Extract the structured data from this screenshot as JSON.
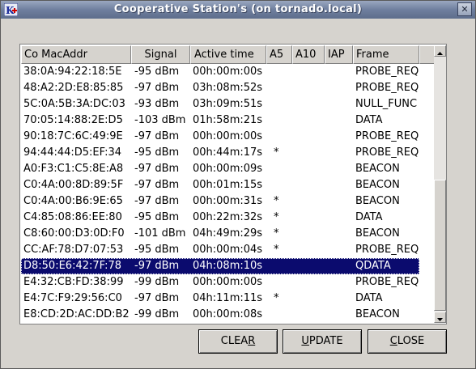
{
  "window": {
    "title": "Cooperative Station's (on tornado.local)",
    "icons": {
      "app": "app-icon",
      "close": "close-icon"
    }
  },
  "table": {
    "columns": [
      "Co MacAddr",
      "Signal",
      "Active time",
      "A5",
      "A10",
      "IAP",
      "Frame"
    ],
    "rows": [
      {
        "mac": "38:0A:94:22:18:5E",
        "signal": "-95 dBm",
        "active": "00h:00m:00s",
        "a5": "",
        "a10": "",
        "iap": "",
        "frame": "PROBE_REQ"
      },
      {
        "mac": "48:A2:2D:E8:85:85",
        "signal": "-97 dBm",
        "active": "03h:08m:52s",
        "a5": "",
        "a10": "",
        "iap": "",
        "frame": "PROBE_REQ"
      },
      {
        "mac": "5C:0A:5B:3A:DC:03",
        "signal": "-93 dBm",
        "active": "03h:09m:51s",
        "a5": "",
        "a10": "",
        "iap": "",
        "frame": "NULL_FUNC"
      },
      {
        "mac": "70:05:14:88:2E:D5",
        "signal": "-103 dBm",
        "active": "01h:58m:21s",
        "a5": "",
        "a10": "",
        "iap": "",
        "frame": "DATA"
      },
      {
        "mac": "90:18:7C:6C:49:9E",
        "signal": "-97 dBm",
        "active": "00h:00m:00s",
        "a5": "",
        "a10": "",
        "iap": "",
        "frame": "PROBE_REQ"
      },
      {
        "mac": "94:44:44:D5:EF:34",
        "signal": "-95 dBm",
        "active": "00h:44m:17s",
        "a5": "*",
        "a10": "",
        "iap": "",
        "frame": "PROBE_REQ"
      },
      {
        "mac": "A0:F3:C1:C5:8E:A8",
        "signal": "-97 dBm",
        "active": "00h:00m:09s",
        "a5": "",
        "a10": "",
        "iap": "",
        "frame": "BEACON"
      },
      {
        "mac": "C0:4A:00:8D:89:5F",
        "signal": "-97 dBm",
        "active": "00h:01m:15s",
        "a5": "",
        "a10": "",
        "iap": "",
        "frame": "BEACON"
      },
      {
        "mac": "C0:4A:00:B6:9E:65",
        "signal": "-97 dBm",
        "active": "00h:00m:31s",
        "a5": "*",
        "a10": "",
        "iap": "",
        "frame": "BEACON"
      },
      {
        "mac": "C4:85:08:86:EE:80",
        "signal": "-95 dBm",
        "active": "00h:22m:32s",
        "a5": "*",
        "a10": "",
        "iap": "",
        "frame": "DATA"
      },
      {
        "mac": "C8:60:00:D3:0D:F0",
        "signal": "-101 dBm",
        "active": "04h:49m:29s",
        "a5": "*",
        "a10": "",
        "iap": "",
        "frame": "BEACON"
      },
      {
        "mac": "CC:AF:78:D7:07:53",
        "signal": "-95 dBm",
        "active": "00h:00m:04s",
        "a5": "*",
        "a10": "",
        "iap": "",
        "frame": "PROBE_REQ"
      },
      {
        "mac": "D8:50:E6:42:7F:78",
        "signal": "-97 dBm",
        "active": "04h:08m:10s",
        "a5": "",
        "a10": "",
        "iap": "",
        "frame": "QDATA",
        "selected": true
      },
      {
        "mac": "E4:32:CB:FD:38:99",
        "signal": "-99 dBm",
        "active": "00h:00m:00s",
        "a5": "",
        "a10": "",
        "iap": "",
        "frame": "PROBE_REQ"
      },
      {
        "mac": "E4:7C:F9:29:56:C0",
        "signal": "-97 dBm",
        "active": "04h:11m:11s",
        "a5": "*",
        "a10": "",
        "iap": "",
        "frame": "DATA"
      },
      {
        "mac": "E8:CD:2D:AC:DD:B2",
        "signal": "-99 dBm",
        "active": "00h:00m:08s",
        "a5": "",
        "a10": "",
        "iap": "",
        "frame": "BEACON"
      }
    ]
  },
  "buttons": {
    "clear": {
      "pre": "CLEA",
      "mn": "R",
      "post": ""
    },
    "update": {
      "pre": "",
      "mn": "U",
      "post": "PDATE"
    },
    "close": {
      "pre": "",
      "mn": "C",
      "post": "LOSE"
    }
  }
}
